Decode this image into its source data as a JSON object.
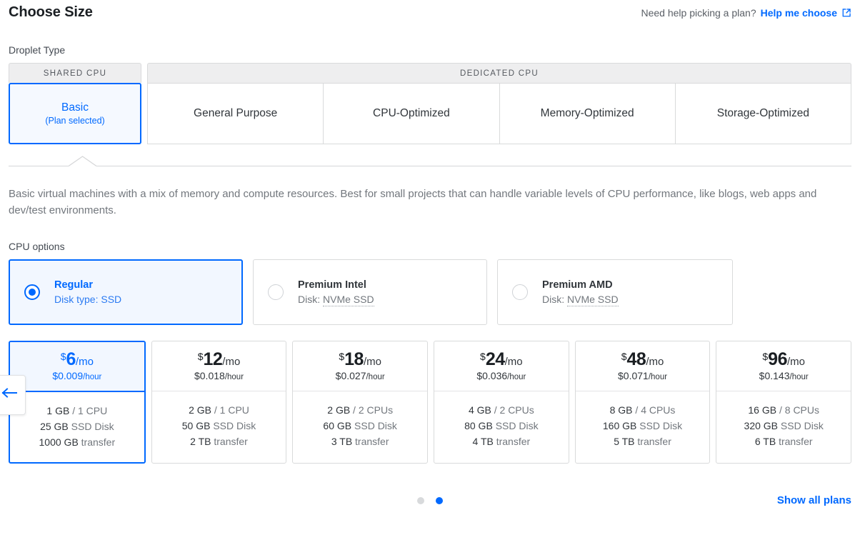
{
  "header": {
    "title": "Choose Size",
    "help_prompt": "Need help picking a plan?",
    "help_link": "Help me choose",
    "external_icon": "external-link-icon"
  },
  "droplet_type": {
    "label": "Droplet Type",
    "groups": [
      {
        "heading": "SHARED CPU",
        "tabs": [
          {
            "name": "Basic",
            "sub": "(Plan selected)",
            "selected": true
          }
        ]
      },
      {
        "heading": "DEDICATED CPU",
        "tabs": [
          {
            "name": "General Purpose",
            "sub": "",
            "selected": false
          },
          {
            "name": "CPU-Optimized",
            "sub": "",
            "selected": false
          },
          {
            "name": "Memory-Optimized",
            "sub": "",
            "selected": false
          },
          {
            "name": "Storage-Optimized",
            "sub": "",
            "selected": false
          }
        ]
      }
    ],
    "description": "Basic virtual machines with a mix of memory and compute resources. Best for small projects that can handle variable levels of CPU performance, like blogs, web apps and dev/test environments."
  },
  "cpu_options": {
    "label": "CPU options",
    "options": [
      {
        "name": "Regular",
        "disk_prefix": "Disk type: ",
        "disk_value": "SSD",
        "dotted": false,
        "selected": true
      },
      {
        "name": "Premium Intel",
        "disk_prefix": "Disk: ",
        "disk_value": "NVMe SSD",
        "dotted": true,
        "selected": false
      },
      {
        "name": "Premium AMD",
        "disk_prefix": "Disk: ",
        "disk_value": "NVMe SSD",
        "dotted": true,
        "selected": false
      }
    ]
  },
  "plans": [
    {
      "currency": "$",
      "monthly": "6",
      "per": "/mo",
      "hourly": "$0.009",
      "hourly_unit": "/hour",
      "memory": "1 GB",
      "cpu": "1 CPU",
      "disk": "25 GB",
      "disk_label": "SSD Disk",
      "transfer": "1000 GB",
      "transfer_label": "transfer",
      "selected": true
    },
    {
      "currency": "$",
      "monthly": "12",
      "per": "/mo",
      "hourly": "$0.018",
      "hourly_unit": "/hour",
      "memory": "2 GB",
      "cpu": "1 CPU",
      "disk": "50 GB",
      "disk_label": "SSD Disk",
      "transfer": "2 TB",
      "transfer_label": "transfer",
      "selected": false
    },
    {
      "currency": "$",
      "monthly": "18",
      "per": "/mo",
      "hourly": "$0.027",
      "hourly_unit": "/hour",
      "memory": "2 GB",
      "cpu": "2 CPUs",
      "disk": "60 GB",
      "disk_label": "SSD Disk",
      "transfer": "3 TB",
      "transfer_label": "transfer",
      "selected": false
    },
    {
      "currency": "$",
      "monthly": "24",
      "per": "/mo",
      "hourly": "$0.036",
      "hourly_unit": "/hour",
      "memory": "4 GB",
      "cpu": "2 CPUs",
      "disk": "80 GB",
      "disk_label": "SSD Disk",
      "transfer": "4 TB",
      "transfer_label": "transfer",
      "selected": false
    },
    {
      "currency": "$",
      "monthly": "48",
      "per": "/mo",
      "hourly": "$0.071",
      "hourly_unit": "/hour",
      "memory": "8 GB",
      "cpu": "4 CPUs",
      "disk": "160 GB",
      "disk_label": "SSD Disk",
      "transfer": "5 TB",
      "transfer_label": "transfer",
      "selected": false
    },
    {
      "currency": "$",
      "monthly": "96",
      "per": "/mo",
      "hourly": "$0.143",
      "hourly_unit": "/hour",
      "memory": "16 GB",
      "cpu": "8 CPUs",
      "disk": "320 GB",
      "disk_label": "SSD Disk",
      "transfer": "6 TB",
      "transfer_label": "transfer",
      "selected": false
    }
  ],
  "carousel": {
    "scroll_left_icon": "arrow-left-icon",
    "dots": [
      {
        "active": false
      },
      {
        "active": true
      }
    ],
    "show_all_label": "Show all plans"
  },
  "colors": {
    "accent": "#0069ff",
    "accent_bg": "#f2f7ff",
    "border": "#d9dadb",
    "muted_text": "#72777d",
    "dot_inactive": "#d8dadc"
  }
}
